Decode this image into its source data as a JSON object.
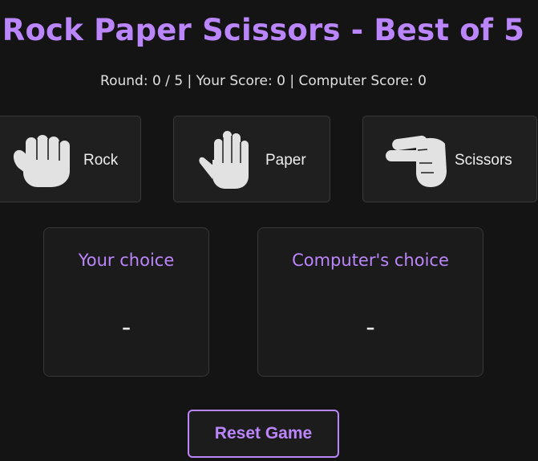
{
  "header": {
    "title": "Rock Paper Scissors - Best of 5"
  },
  "status": {
    "text": "Round: 0 / 5 | Your Score: 0 | Computer Score: 0",
    "round": 0,
    "total_rounds": 5,
    "your_score": 0,
    "computer_score": 0
  },
  "choices": [
    {
      "label": "Rock",
      "icon": "fist-icon"
    },
    {
      "label": "Paper",
      "icon": "open-hand-icon"
    },
    {
      "label": "Scissors",
      "icon": "two-finger-hand-icon"
    }
  ],
  "player_panel": {
    "title": "Your choice",
    "value": "-"
  },
  "computer_panel": {
    "title": "Computer's choice",
    "value": "-"
  },
  "reset_button": {
    "label": "Reset Game"
  },
  "colors": {
    "background": "#141414",
    "accent": "#bb86fc",
    "card": "#1f1f1f",
    "icon": "#e2e2e2"
  }
}
